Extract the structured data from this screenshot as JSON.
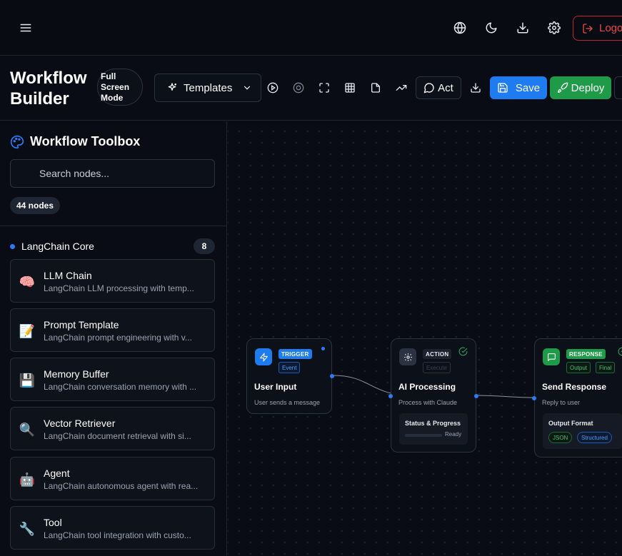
{
  "header": {
    "logout_label": "Logout",
    "icons": [
      "menu-icon",
      "globe-icon",
      "moon-icon",
      "download-icon",
      "gear-icon",
      "logout-icon"
    ]
  },
  "toolbar": {
    "title": "Workflow Builder",
    "fullscreen_label": "Full Screen Mode",
    "templates_label": "Templates",
    "act_label": "Act",
    "save_label": "Save",
    "deploy_label": "Deploy",
    "icons": [
      "play-icon",
      "record-icon",
      "fullscreen-icon",
      "grid-icon",
      "file-icon",
      "trend-icon",
      "chat-icon",
      "download-icon"
    ]
  },
  "sidebar": {
    "title": "Workflow Toolbox",
    "search_placeholder": "Search nodes...",
    "node_count": "44 nodes",
    "category": {
      "name": "LangChain Core",
      "count": "8"
    },
    "items": [
      {
        "name": "LLM Chain",
        "desc": "LangChain LLM processing with temp...",
        "icon": "🧠"
      },
      {
        "name": "Prompt Template",
        "desc": "LangChain prompt engineering with v...",
        "icon": "📝"
      },
      {
        "name": "Memory Buffer",
        "desc": "LangChain conversation memory with ...",
        "icon": "💾"
      },
      {
        "name": "Vector Retriever",
        "desc": "LangChain document retrieval with si...",
        "icon": "🔍"
      },
      {
        "name": "Agent",
        "desc": "LangChain autonomous agent with rea...",
        "icon": "🤖"
      },
      {
        "name": "Tool",
        "desc": "LangChain tool integration with custo...",
        "icon": "🔧"
      }
    ]
  },
  "canvas": {
    "nodes": [
      {
        "type": "TRIGGER",
        "tags": [
          "Event"
        ],
        "title": "User Input",
        "desc": "User sends a message",
        "color": "#1e7bf0"
      },
      {
        "type": "ACTION",
        "tags": [
          "Execute"
        ],
        "title": "AI Processing",
        "desc": "Process with Claude",
        "status_title": "Status & Progress",
        "status_value": "Ready",
        "progress": 0,
        "color": "#2b3342"
      },
      {
        "type": "RESPONSE",
        "tags": [
          "Output",
          "Final"
        ],
        "title": "Send Response",
        "desc": "Reply to user",
        "format_title": "Output Format",
        "formats": [
          "JSON",
          "Structured"
        ],
        "color": "#1f9a48"
      }
    ]
  }
}
